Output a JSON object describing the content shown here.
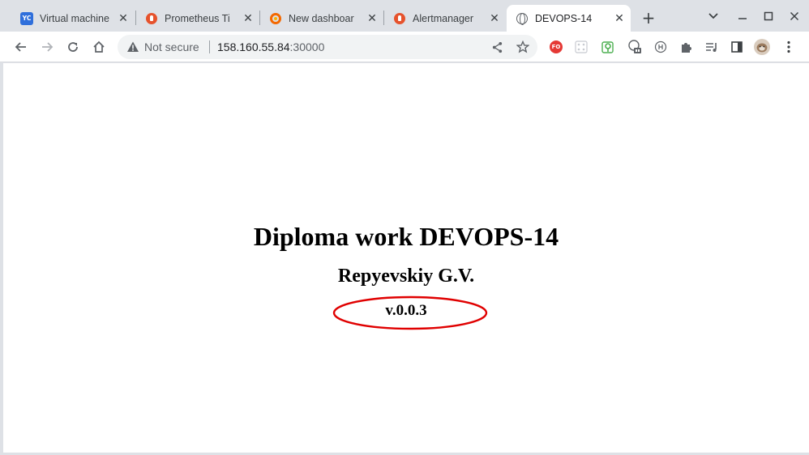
{
  "tabs": [
    {
      "title": "Virtual machine",
      "favicon": "yandex-cloud-icon",
      "active": false
    },
    {
      "title": "Prometheus Ti",
      "favicon": "prometheus-icon",
      "active": false
    },
    {
      "title": "New dashboar",
      "favicon": "grafana-icon",
      "active": false
    },
    {
      "title": "Alertmanager",
      "favicon": "prometheus-icon",
      "active": false
    },
    {
      "title": "DEVOPS-14",
      "favicon": "globe-icon",
      "active": true
    }
  ],
  "favicon_text": {
    "yc": "YC"
  },
  "omnibox": {
    "security_label": "Not secure",
    "host": "158.160.55.84",
    "port": ":30000"
  },
  "page": {
    "heading": "Diploma work DEVOPS-14",
    "author": "Repyevskiy G.V.",
    "version": "v.0.0.3"
  },
  "colors": {
    "tabstrip_bg": "#dee1e6",
    "highlight_ellipse": "#e00000",
    "extension_fo": "#e53935"
  },
  "extensions": [
    {
      "name": "fo-extension-icon",
      "label": "FO"
    },
    {
      "name": "grid-extension-icon"
    },
    {
      "name": "map-pin-extension-icon"
    },
    {
      "name": "translate-extension-icon"
    },
    {
      "name": "circle-h-extension-icon"
    },
    {
      "name": "puzzle-extensions-icon"
    },
    {
      "name": "media-control-icon"
    },
    {
      "name": "side-panel-icon"
    },
    {
      "name": "profile-avatar"
    },
    {
      "name": "menu-kebab-icon"
    }
  ]
}
